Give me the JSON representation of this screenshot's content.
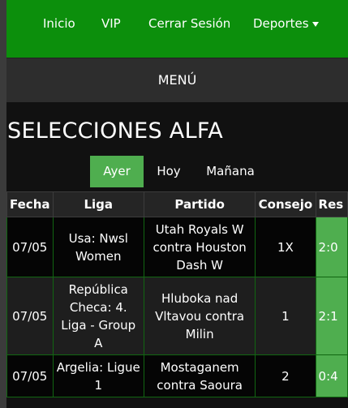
{
  "nav": {
    "items": [
      {
        "label": "Inicio"
      },
      {
        "label": "VIP"
      },
      {
        "label": "Cerrar Sesión"
      },
      {
        "label": "Deportes"
      }
    ]
  },
  "menu": {
    "label": "MENÚ"
  },
  "page": {
    "title": "SELECCIONES ALFA"
  },
  "tabs": [
    {
      "label": "Ayer",
      "active": true
    },
    {
      "label": "Hoy",
      "active": false
    },
    {
      "label": "Mañana",
      "active": false
    }
  ],
  "table": {
    "headers": [
      "Fecha",
      "Liga",
      "Partido",
      "Consejo",
      "Res"
    ],
    "rows": [
      {
        "fecha": "07/05",
        "liga": "Usa: Nwsl Women",
        "partido": "Utah Royals W contra Houston Dash W",
        "consejo": "1X",
        "res": "2:0"
      },
      {
        "fecha": "07/05",
        "liga": "República Checa: 4. Liga - Group A",
        "partido": "Hluboka nad Vltavou contra Milin",
        "consejo": "1",
        "res": "2:1"
      },
      {
        "fecha": "07/05",
        "liga": "Argelia: Ligue 1",
        "partido": "Mostaganem contra Saoura",
        "consejo": "2",
        "res": "0:4"
      }
    ]
  },
  "colors": {
    "nav_bg": "#0c8f0c",
    "accent": "#4fae4f",
    "row_border": "#116611"
  }
}
